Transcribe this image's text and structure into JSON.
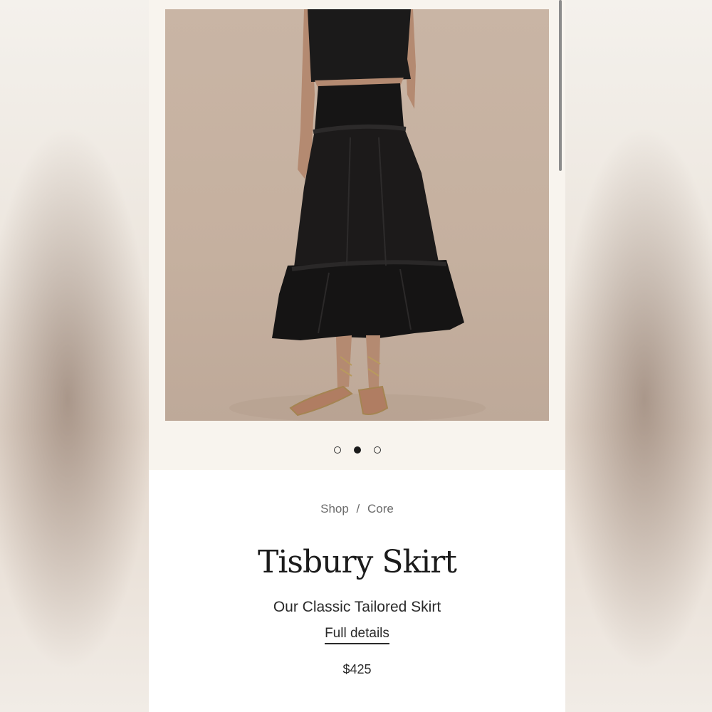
{
  "breadcrumb": {
    "shop": "Shop",
    "separator": "/",
    "category": "Core"
  },
  "product": {
    "title": "Tisbury Skirt",
    "subtitle": "Our Classic Tailored Skirt",
    "details_link": "Full details",
    "price": "$425"
  },
  "gallery": {
    "image_count": 3,
    "active_index": 2,
    "image_alt": "Model wearing black tiered maxi skirt with cropped black top and strappy sandals"
  },
  "colors": {
    "skirt": "#1a1818",
    "background_wall": "#c7b3a3",
    "gallery_bg": "#f8f4ee"
  }
}
